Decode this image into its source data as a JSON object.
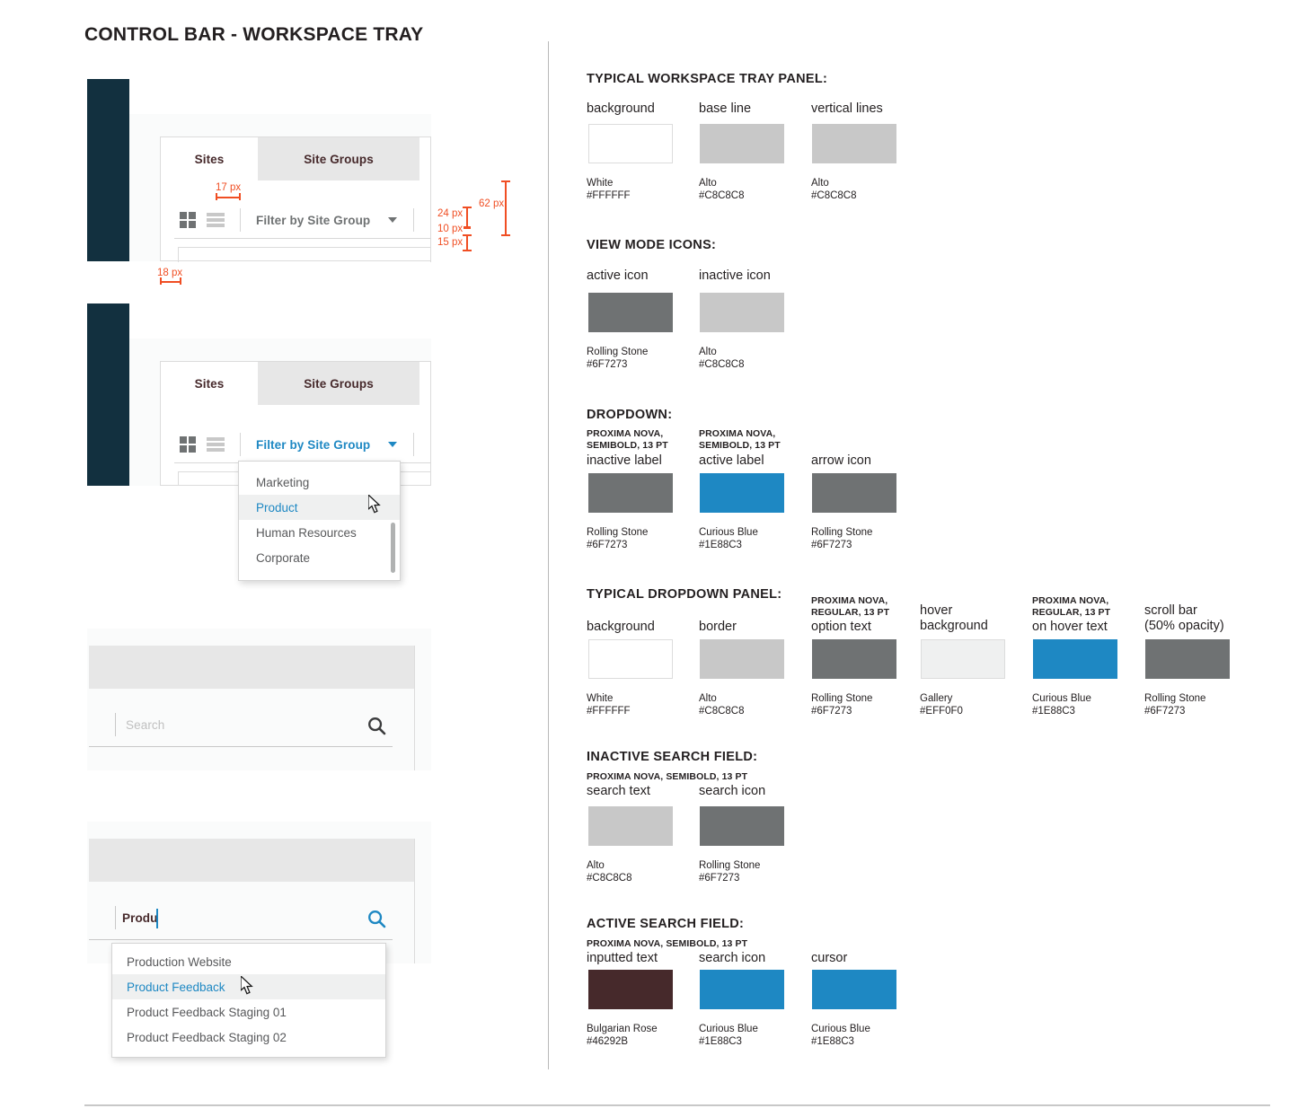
{
  "page": {
    "title": "CONTROL BAR - WORKSPACE TRAY"
  },
  "mockups": {
    "tabs": {
      "active": "Sites",
      "inactive": "Site Groups"
    },
    "filter_label": "Filter by Site Group",
    "dropdown_options": [
      "Marketing",
      "Product",
      "Human Resources",
      "Corporate"
    ],
    "dropdown_hover_option": "Product",
    "search_placeholder": "Search",
    "search_value": "Produ",
    "search_results": [
      "Production Website",
      "Product Feedback",
      "Product Feedback Staging 01",
      "Product Feedback Staging 02"
    ],
    "search_hover_result": "Product Feedback",
    "dimensions": {
      "d17": "17 px",
      "d18": "18 px",
      "d24": "24 px",
      "d10": "10 px",
      "d15": "15 px",
      "d62": "62 px"
    }
  },
  "spec": {
    "sections": [
      {
        "title": "TYPICAL WORKSPACE TRAY PANEL:",
        "items": [
          {
            "label": "background",
            "color": "#FFFFFF",
            "name": "White",
            "hex": "#FFFFFF",
            "outlined": true
          },
          {
            "label": "base line",
            "color": "#C8C8C8",
            "name": "Alto",
            "hex": "#C8C8C8"
          },
          {
            "label": "vertical lines",
            "color": "#C8C8C8",
            "name": "Alto",
            "hex": "#C8C8C8"
          }
        ]
      },
      {
        "title": "VIEW MODE ICONS:",
        "items": [
          {
            "label": "active icon",
            "color": "#6F7273",
            "name": "Rolling Stone",
            "hex": "#6F7273"
          },
          {
            "label": "inactive icon",
            "color": "#C8C8C8",
            "name": "Alto",
            "hex": "#C8C8C8"
          }
        ]
      },
      {
        "title": "DROPDOWN:",
        "items": [
          {
            "font_note": "PROXIMA NOVA,\nSEMIBOLD, 13 PT",
            "label": "inactive label",
            "color": "#6F7273",
            "name": "Rolling Stone",
            "hex": "#6F7273"
          },
          {
            "font_note": "PROXIMA NOVA,\nSEMIBOLD, 13 PT",
            "label": "active label",
            "color": "#1E88C3",
            "name": "Curious Blue",
            "hex": "#1E88C3"
          },
          {
            "label": "arrow icon",
            "color": "#6F7273",
            "name": "Rolling Stone",
            "hex": "#6F7273"
          }
        ]
      },
      {
        "title": "TYPICAL DROPDOWN PANEL:",
        "items": [
          {
            "label": "background",
            "color": "#FFFFFF",
            "name": "White",
            "hex": "#FFFFFF",
            "outlined": true
          },
          {
            "label": "border",
            "color": "#C8C8C8",
            "name": "Alto",
            "hex": "#C8C8C8"
          },
          {
            "font_note": "PROXIMA NOVA,\nREGULAR, 13 PT",
            "label": "option text",
            "color": "#6F7273",
            "name": "Rolling Stone",
            "hex": "#6F7273"
          },
          {
            "label": "hover\nbackground",
            "color": "#EFF0F0",
            "name": "Gallery",
            "hex": "#EFF0F0",
            "outlined": true
          },
          {
            "font_note": "PROXIMA NOVA,\nREGULAR, 13 PT",
            "label": "on hover text",
            "color": "#1E88C3",
            "name": "Curious Blue",
            "hex": "#1E88C3"
          },
          {
            "label": "scroll bar\n(50% opacity)",
            "color": "#6F7273",
            "name": "Rolling Stone",
            "hex": "#6F7273"
          }
        ]
      },
      {
        "title": "INACTIVE SEARCH FIELD:",
        "font_note": "PROXIMA NOVA, SEMIBOLD, 13 PT",
        "items": [
          {
            "label": "search text",
            "color": "#C8C8C8",
            "name": "Alto",
            "hex": "#C8C8C8"
          },
          {
            "label": "search icon",
            "color": "#6F7273",
            "name": "Rolling Stone",
            "hex": "#6F7273"
          }
        ]
      },
      {
        "title": "ACTIVE SEARCH FIELD:",
        "font_note": "PROXIMA NOVA, SEMIBOLD, 13 PT",
        "items": [
          {
            "label": "inputted text",
            "color": "#46292B",
            "name": "Bulgarian Rose",
            "hex": "#46292B"
          },
          {
            "label": "search icon",
            "color": "#1E88C3",
            "name": "Curious Blue",
            "hex": "#1E88C3"
          },
          {
            "label": "cursor",
            "color": "#1E88C3",
            "name": "Curious Blue",
            "hex": "#1E88C3"
          }
        ]
      }
    ]
  }
}
